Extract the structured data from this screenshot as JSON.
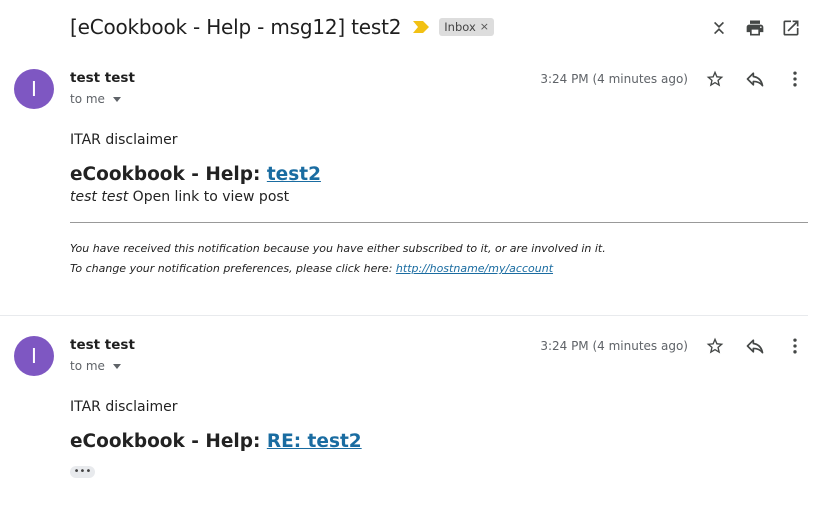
{
  "thread": {
    "subject": "[eCookbook - Help - msg12] test2",
    "label": "Inbox",
    "label_remove": "×",
    "importance_color": "#f2c114"
  },
  "toolbar": {
    "icons": [
      "expand-collapse-icon",
      "print-icon",
      "open-in-new-window-icon"
    ]
  },
  "messages": [
    {
      "avatar_letter": "I",
      "avatar_color": "#7e57c2",
      "sender": "test test",
      "recipient": "to me",
      "time": "3:24 PM (4 minutes ago)",
      "disclaimer": "ITAR disclaimer",
      "heading_prefix": "eCookbook - Help: ",
      "heading_link": "test2",
      "post_author": "test test",
      "post_text": " Open link to view post",
      "notice_line1": "You have received this notification because you have either subscribed to it, or are involved in it.",
      "notice_line2_prefix": "To change your notification preferences, please click here: ",
      "notice_link": "http://hostname/my/account"
    },
    {
      "avatar_letter": "I",
      "avatar_color": "#7e57c2",
      "sender": "test test",
      "recipient": "to me",
      "time": "3:24 PM (4 minutes ago)",
      "disclaimer": "ITAR disclaimer",
      "heading_prefix": "eCookbook - Help: ",
      "heading_link": "RE: test2",
      "trimmed_indicator": "•••"
    }
  ],
  "colors": {
    "link": "#1a6ca1",
    "avatar": "#7e57c2",
    "label_chip_bg": "#dddddd"
  }
}
